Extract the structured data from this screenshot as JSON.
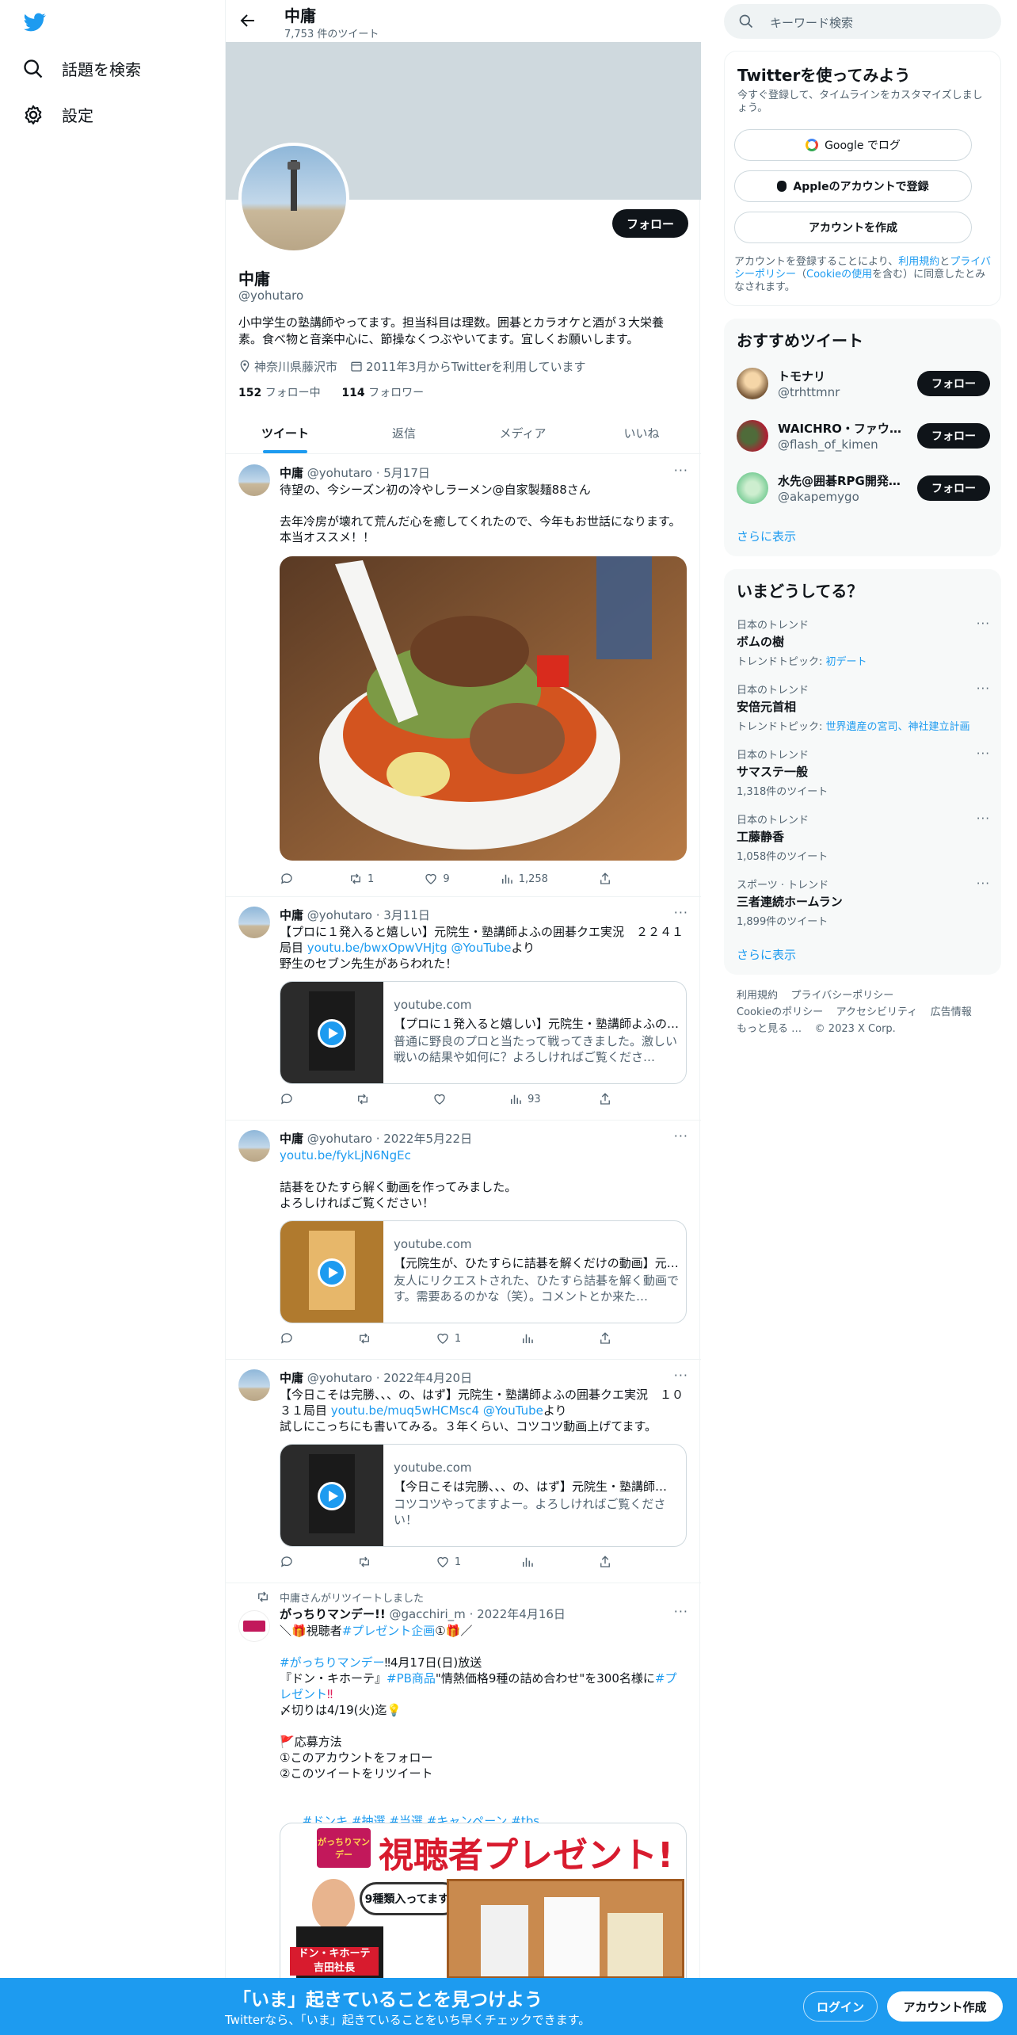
{
  "sidebar": {
    "items": [
      {
        "label": "話題を検索",
        "icon": "search-icon"
      },
      {
        "label": "設定",
        "icon": "gear-icon"
      }
    ]
  },
  "header": {
    "title": "中庸",
    "tweet_count": "7,753 件のツイート"
  },
  "profile": {
    "name": "中庸",
    "handle": "@yohutaro",
    "bio": "小中学生の塾講師やってます。担当科目は理数。囲碁とカラオケと酒が３大栄養素。食べ物と音楽中心に、節操なくつぶやいてます。宜しくお願いします。",
    "location": "神奈川県藤沢市",
    "joined": "2011年3月からTwitterを利用しています",
    "following_count": "152",
    "following_label": "フォロー中",
    "followers_count": "114",
    "followers_label": "フォロワー",
    "follow_button": "フォロー"
  },
  "tabs": [
    "ツイート",
    "返信",
    "メディア",
    "いいね"
  ],
  "tweets": [
    {
      "name": "中庸",
      "handle": "@yohutaro",
      "date": "5月17日",
      "text": "待望の、今シーズン初の冷やしラーメン@自家製麺88さん\n\n去年冷房が壊れて荒んだ心を癒してくれたので、今年もお世話になります。本当オススメ！！",
      "reply": "",
      "retweet": "1",
      "like": "9",
      "views": "1,258"
    },
    {
      "name": "中庸",
      "handle": "@yohutaro",
      "date": "3月11日",
      "text_a": "【プロに１発入ると嬉しい】元院生・塾講師よふの囲碁クエ実況　２２４１局目 ",
      "link": "youtu.be/bwxOpwVHjtg",
      "text_b": " ",
      "mention": "@YouTube",
      "text_c": "より\n野生のセブン先生があらわれた！",
      "card": {
        "domain": "youtube.com",
        "title": "【プロに１発入ると嬉しい】元院生・塾講師よふの…",
        "desc": "普通に野良のプロと当たって戦ってきました。激しい戦いの結果や如何に？よろしければご覧くださ…"
      },
      "reply": "",
      "retweet": "",
      "like": "",
      "views": "93"
    },
    {
      "name": "中庸",
      "handle": "@yohutaro",
      "date": "2022年5月22日",
      "link": "youtu.be/fykLjN6NgEc",
      "text": "詰碁をひたすら解く動画を作ってみました。\nよろしければご覧ください！",
      "card": {
        "domain": "youtube.com",
        "title": "【元院生が、ひたすらに詰碁を解くだけの動画】元…",
        "desc": "友人にリクエストされた、ひたすら詰碁を解く動画です。需要あるのかな（笑）。コメントとか来た…"
      },
      "reply": "",
      "retweet": "",
      "like": "1",
      "views": ""
    },
    {
      "name": "中庸",
      "handle": "@yohutaro",
      "date": "2022年4月20日",
      "text_a": "【今日こそは完勝、、、の、はず】元院生・塾講師よふの囲碁クエ実況　１０３１局目 ",
      "link": "youtu.be/muq5wHCMsc4",
      "text_b": " ",
      "mention": "@YouTube",
      "text_c": "より\n試しにこっちにも書いてみる。３年くらい、コツコツ動画上げてます。",
      "card": {
        "domain": "youtube.com",
        "title": "【今日こそは完勝、、、の、はず】元院生・塾講師…",
        "desc": "コツコツやってますよー。よろしければご覧ください！"
      },
      "reply": "",
      "retweet": "",
      "like": "1",
      "views": ""
    },
    {
      "retweet_label": "中庸さんがリツイートしました",
      "name": "がっちりマンデー!!",
      "handle": "@gacchiri_m",
      "date": "2022年4月16日",
      "line1_a": "＼🎁視聴者",
      "line1_tag": "#プレゼント企画",
      "line1_b": "①🎁／",
      "line2_tag": "#がっちりマンデー",
      "line2_b": "‼4月17日(日)放送",
      "line3_a": "『ドン・キホーテ』",
      "line3_tag": "#PB商品",
      "line3_b": "\"情熱価格9種の詰め合わせ\"を300名様に",
      "line3_tag2": "#プレゼント",
      "line3_c": "‼",
      "line4": "〆切りは4/19(火)迄💡",
      "line5": "🚩応募方法\n①このアカウントをフォロー\n②このツイートをリツイート",
      "tags": [
        "#ドンキ",
        "#抽選",
        "#当選",
        "#キャンペーン",
        "#tbs"
      ],
      "promo_title": "視聴者プレゼント!",
      "promo_bubble": "9種類入ってます!",
      "promo_caption_1": "ドン・キホーテ",
      "promo_caption_2": "吉田社長",
      "promo_logo": "がっちりマンデー"
    }
  ],
  "search": {
    "placeholder": "キーワード検索"
  },
  "signup_box": {
    "title": "Twitterを使ってみよう",
    "subtitle": "今すぐ登録して、タイムラインをカスタマイズしましょう。",
    "google": "Google でログ",
    "apple": "Appleのアカウントで登録",
    "create": "アカウントを作成",
    "legal_a": "アカウントを登録することにより、",
    "legal_terms": "利用規約",
    "legal_b": "と",
    "legal_privacy": "プライバシーポリシー",
    "legal_c": "（",
    "legal_cookie": "Cookieの使用",
    "legal_d": "を含む）に同意したとみなされます。"
  },
  "who_to_follow": {
    "title": "おすすめツイート",
    "users": [
      {
        "name": "トモナリ",
        "handle": "@trhttmnr"
      },
      {
        "name": "WAICHRO・ファウス…",
        "handle": "@flash_of_kimen"
      },
      {
        "name": "水先@囲碁RPG開発…",
        "handle": "@akapemygo"
      }
    ],
    "follow": "フォロー",
    "more": "さらに表示"
  },
  "trends": {
    "title": "いまどうしてる？",
    "items": [
      {
        "context": "日本のトレンド",
        "name": "ボムの樹",
        "topic_label": "トレンドトピック: ",
        "topic": "初デート",
        "count": ""
      },
      {
        "context": "日本のトレンド",
        "name": "安倍元首相",
        "topic_label": "トレンドトピック: ",
        "topic": "世界遺産の宮司、神社建立計画",
        "count": ""
      },
      {
        "context": "日本のトレンド",
        "name": "サマステ一般",
        "topic_label": "",
        "topic": "",
        "count": "1,318件のツイート"
      },
      {
        "context": "日本のトレンド",
        "name": "工藤静香",
        "topic_label": "",
        "topic": "",
        "count": "1,058件のツイート"
      },
      {
        "context": "スポーツ · トレンド",
        "name": "三者連続ホームラン",
        "topic_label": "",
        "topic": "",
        "count": "1,899件のツイート"
      }
    ],
    "more": "さらに表示"
  },
  "footer_links": [
    "利用規約",
    "プライバシーポリシー",
    "Cookieのポリシー",
    "アクセシビリティ",
    "広告情報",
    "もっと見る …",
    "© 2023 X Corp."
  ],
  "bottom_bar": {
    "title": "「いま」起きていることを見つけよう",
    "subtitle": "Twitterなら、「いま」起きていることをいち早くチェックできます。",
    "login": "ログイン",
    "signup": "アカウント作成"
  },
  "colors": {
    "accent": "#1d9bf0",
    "text": "#0f1419",
    "secondary": "#536471",
    "banner": "#cfd9de"
  }
}
